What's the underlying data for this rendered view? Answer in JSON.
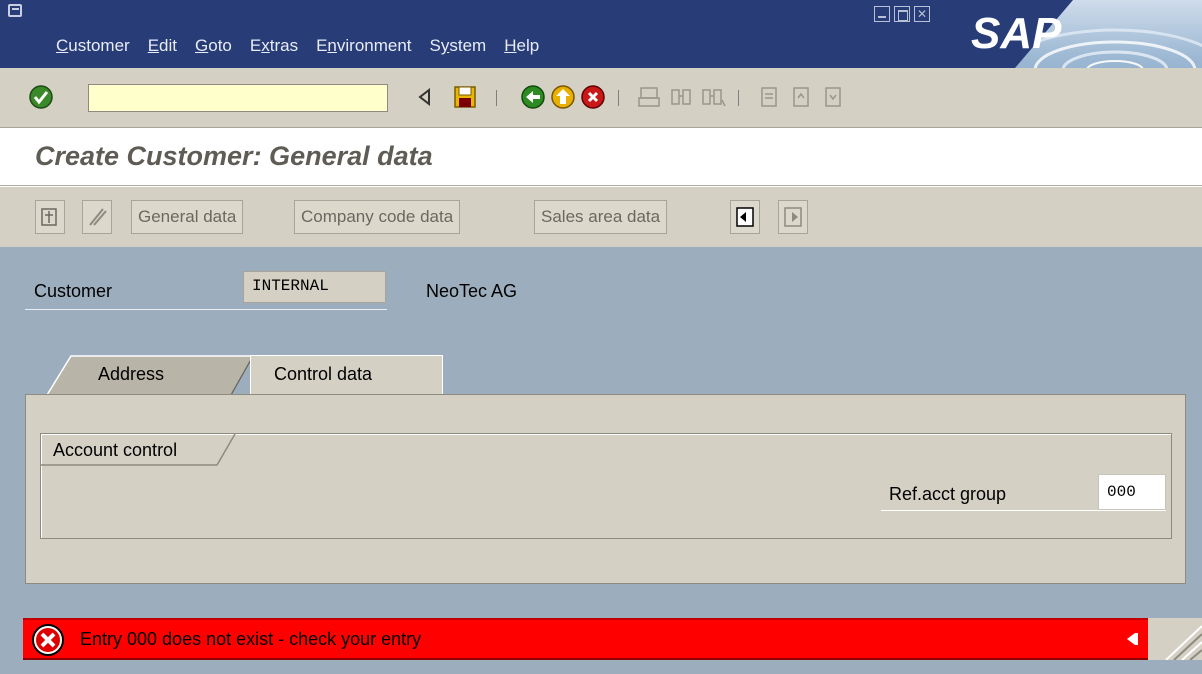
{
  "window": {
    "menu": [
      {
        "pre": "",
        "u": "C",
        "post": "ustomer"
      },
      {
        "pre": "",
        "u": "E",
        "post": "dit"
      },
      {
        "pre": "",
        "u": "G",
        "post": "oto"
      },
      {
        "pre": "E",
        "u": "x",
        "post": "tras"
      },
      {
        "pre": "E",
        "u": "n",
        "post": "vironment"
      },
      {
        "pre": "S",
        "u": "y",
        "post": "stem"
      },
      {
        "pre": "",
        "u": "H",
        "post": "elp"
      }
    ],
    "logo_text": "SAP"
  },
  "toolbar": {
    "command_field_value": "",
    "icons": [
      "enter-icon",
      "command-dropdown-icon",
      "back-arrow-icon",
      "save-icon",
      "back-icon",
      "exit-icon",
      "cancel-icon",
      "print-icon",
      "find-icon",
      "find-next-icon",
      "first-page-icon",
      "previous-page-icon",
      "next-page-icon"
    ]
  },
  "screen": {
    "title": "Create Customer: General data"
  },
  "app_toolbar": {
    "buttons": [
      "General data",
      "Company code data",
      "Sales area data"
    ],
    "icons": [
      "other-customer-icon",
      "change-display-icon",
      "previous-screen-icon",
      "next-screen-icon"
    ]
  },
  "customer": {
    "label": "Customer",
    "value": "INTERNAL",
    "name": "NeoTec AG"
  },
  "tabs": {
    "items": [
      "Address",
      "Control data"
    ],
    "active": "Control data"
  },
  "account_control": {
    "title": "Account control",
    "ref_acct_group_label": "Ref.acct group",
    "ref_acct_group_value": "000"
  },
  "status": {
    "type": "error",
    "message": "Entry 000  does not exist - check your entry",
    "icon": "error-icon",
    "color": "#ff0000"
  },
  "colors": {
    "title_bar": "#283c78",
    "toolbar": "#d4d0c4",
    "background": "#9caebe",
    "input_yellow": "#ffffcc"
  }
}
